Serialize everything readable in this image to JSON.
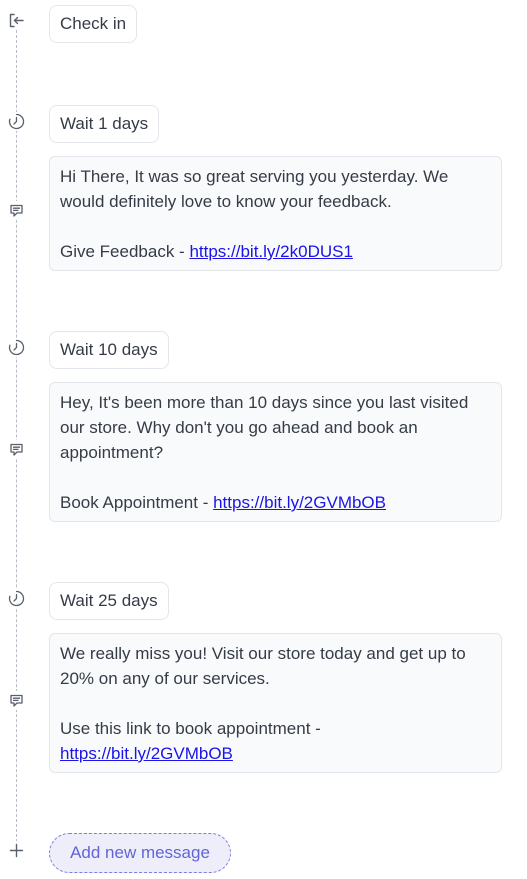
{
  "trigger": {
    "label": "Check in",
    "icon": "check-in-icon"
  },
  "steps": [
    {
      "wait_label": "Wait 1 days",
      "message_lines": [
        "Hi There, It was so great serving you yesterday. We",
        "would definitely love to know your feedback."
      ],
      "cta_lines": [
        {
          "prefix": "Give Feedback - ",
          "link": "https://bit.ly/2k0DUS1"
        }
      ]
    },
    {
      "wait_label": "Wait 10 days",
      "message_lines": [
        "Hey, It's been more than 10 days since you last visited",
        "our store. Why don't you go ahead and book an",
        "appointment?"
      ],
      "cta_lines": [
        {
          "prefix": "Book Appointment - ",
          "link": "https://bit.ly/2GVMbOB"
        }
      ]
    },
    {
      "wait_label": "Wait 25 days",
      "message_lines": [
        "We really miss you! Visit our store today and get up to",
        "20% on any of our services."
      ],
      "cta_lines": [
        {
          "prefix": "Use this link to book appointment -",
          "link": ""
        },
        {
          "prefix": "",
          "link": "https://bit.ly/2GVMbOB"
        }
      ]
    }
  ],
  "add_button": {
    "label": "Add new message",
    "icon": "plus-icon"
  },
  "icons": {
    "wait": "clock-icon",
    "message": "message-icon"
  },
  "colors": {
    "link": "#1a14e8",
    "accent": "#6264d6",
    "border": "#e3e6ea",
    "card_bg": "#f9fafb",
    "timeline": "#b7bcc6"
  }
}
